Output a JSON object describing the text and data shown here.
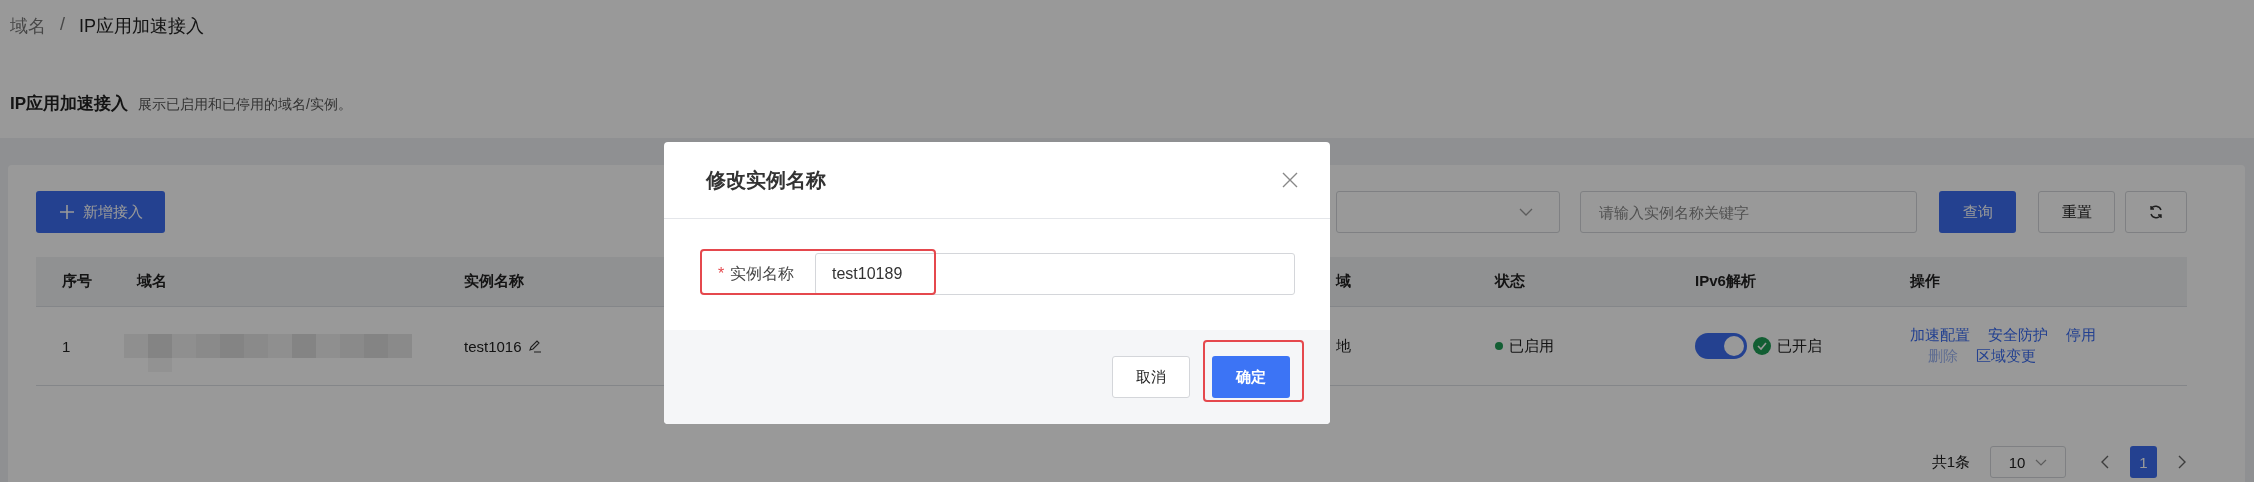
{
  "breadcrumb": [
    {
      "label": "域名",
      "current": false
    },
    {
      "label": "IP应用加速接入",
      "current": true
    }
  ],
  "breadcrumb_separator": "/",
  "page_header": {
    "title": "IP应用加速接入",
    "description": "展示已启用和已停用的域名/实例。"
  },
  "toolbar": {
    "add_button": "新增接入",
    "search": {
      "placeholder": "请输入实例名称关键字"
    },
    "query_button": "查询",
    "reset_button": "重置"
  },
  "table": {
    "columns": [
      "序号",
      "域名",
      "实例名称",
      "域",
      "状态",
      "IPv6解析",
      "操作"
    ],
    "rows": [
      {
        "index": "1",
        "instance_name": "test1016",
        "column_4": "地",
        "status": {
          "label": "已启用",
          "color": "#135e33"
        },
        "ipv6": {
          "on": true,
          "label": "已开启"
        },
        "actions": [
          {
            "label": "加速配置",
            "disabled": false
          },
          {
            "label": "安全防护",
            "disabled": false
          },
          {
            "label": "停用",
            "disabled": false
          },
          {
            "label": "删除",
            "disabled": true
          },
          {
            "label": "区域变更",
            "disabled": false
          }
        ]
      }
    ]
  },
  "pagination": {
    "total": "共1条",
    "page_size": "10",
    "pages": [
      {
        "label": "1",
        "selected": true
      }
    ]
  },
  "modal": {
    "title": "修改实例名称",
    "field": {
      "required_mark": "*",
      "label": "实例名称",
      "value": "test10189"
    },
    "cancel": "取消",
    "confirm": "确定"
  }
}
